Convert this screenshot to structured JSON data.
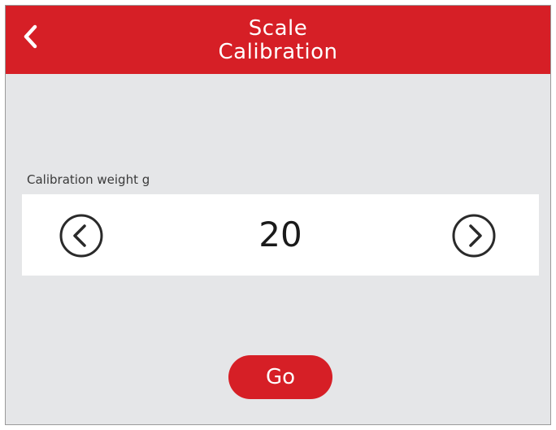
{
  "header": {
    "title_line1": "Scale",
    "title_line2": "Calibration",
    "back_icon": "chevron-left-icon"
  },
  "calibration": {
    "label": "Calibration weight g",
    "value": "20",
    "prev_icon": "circle-chevron-left-icon",
    "next_icon": "circle-chevron-right-icon"
  },
  "actions": {
    "go_label": "Go"
  },
  "colors": {
    "accent": "#d61f26",
    "background": "#e5e6e8",
    "panel": "#ffffff"
  }
}
